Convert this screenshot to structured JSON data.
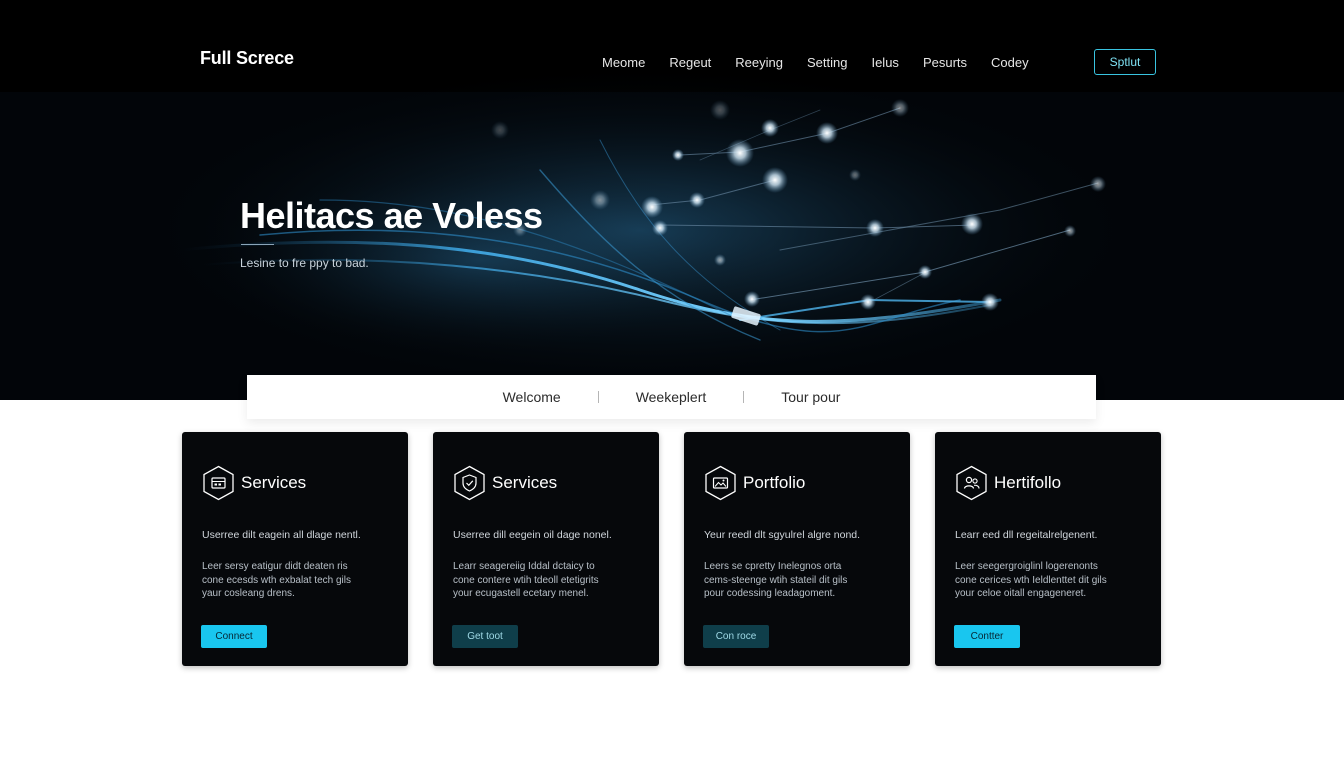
{
  "header": {
    "logo": "Full Screce",
    "nav": [
      "Meome",
      "Regeut",
      "Reeying",
      "Setting",
      "Ielus",
      "Pesurts",
      "Codey"
    ],
    "cta": "Sptlut"
  },
  "hero": {
    "title": "Helitacs ae Voless",
    "subtitle": "Lesine to fre ppy to bad."
  },
  "tabs": [
    "Welcome",
    "Weekeplert",
    "Tour pour"
  ],
  "cards": [
    {
      "icon": "calendar-icon",
      "title": "Services",
      "lead": "Userree dilt eagein all dlage nentl.",
      "body": [
        "Leer sersy eatigur didt deaten ris",
        "cone ecesds wth exbalat tech gils",
        "yaur cosleang drens."
      ],
      "button": "Connect",
      "button_style": "bright"
    },
    {
      "icon": "shield-icon",
      "title": "Services",
      "lead": "Userree dill eegein oil dage nonel.",
      "body": [
        "Learr seagereiig Iddal dctaicy to",
        "cone contere wtih tdeoll etetigrits",
        "your ecugastell ecetary menel."
      ],
      "button": "Get toot",
      "button_style": "dark"
    },
    {
      "icon": "portfolio-icon",
      "title": "Portfolio",
      "lead": "Yeur reedl dlt sgyulrel algre nond.",
      "body": [
        "Leers se cpretty Inelegnos orta",
        "cems-steenge wtih stateil dit gils",
        "pour codessing leadagoment."
      ],
      "button": "Con roce",
      "button_style": "dark"
    },
    {
      "icon": "people-icon",
      "title": "Hertifollo",
      "lead": "Learr eed dll regeitalrelgenent.",
      "body": [
        "Leer seegergroiglinl logerenonts",
        "cone cerices wth Ieldlenttet dit gils",
        "your celoe oitall engageneret."
      ],
      "button": "Contter",
      "button_style": "bright"
    }
  ],
  "colors": {
    "accent": "#19c6ef",
    "accent_dark": "#0f3e4a",
    "hero_bg": "#000000",
    "card_bg": "#06080b"
  }
}
